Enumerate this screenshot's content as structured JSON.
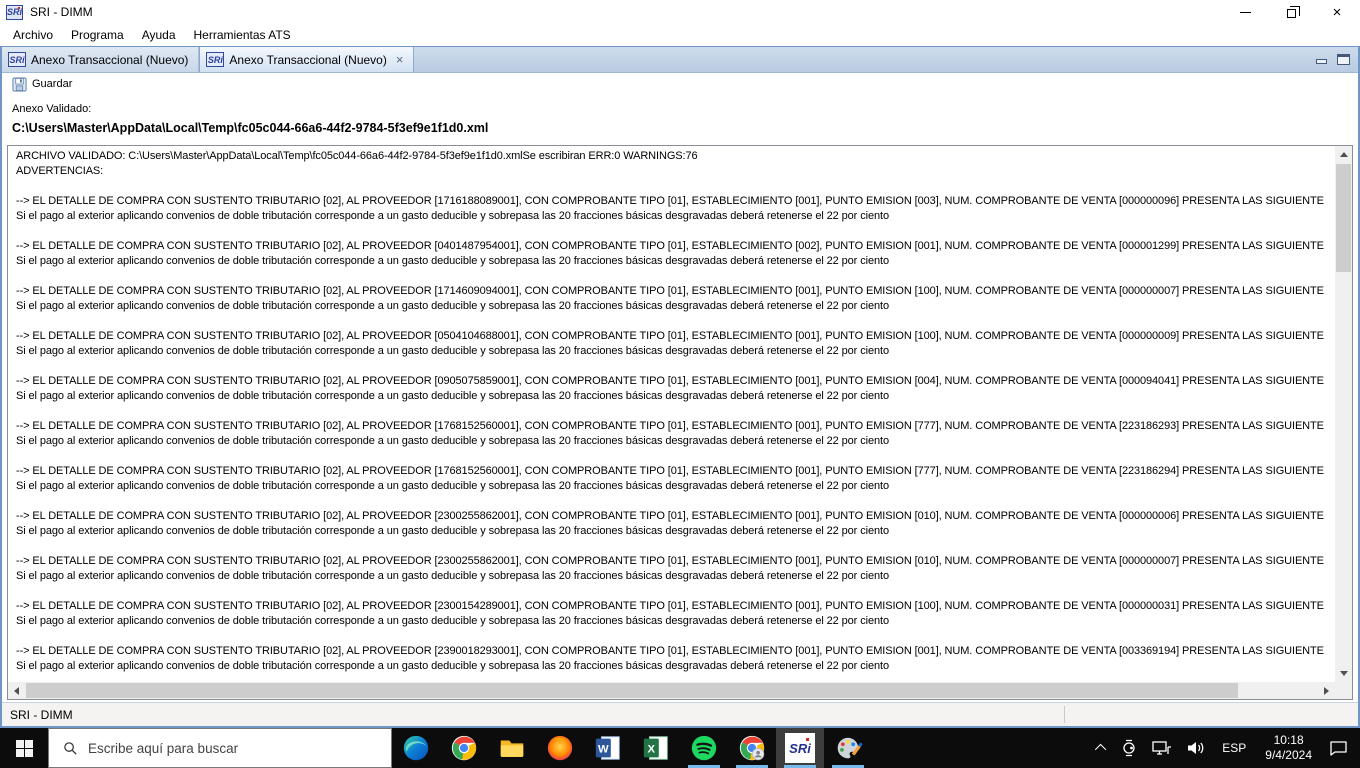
{
  "window": {
    "title": "SRI - DIMM",
    "logo_text": "SRi"
  },
  "menu": {
    "items": [
      {
        "label": "Archivo"
      },
      {
        "label": "Programa"
      },
      {
        "label": "Ayuda"
      },
      {
        "label": "Herramientas ATS"
      }
    ]
  },
  "tab_bar": {
    "tabs": [
      {
        "label": "Anexo Transaccional (Nuevo)",
        "active": false
      },
      {
        "label": "Anexo Transaccional (Nuevo)",
        "active": true,
        "close": "×"
      }
    ]
  },
  "toolbar": {
    "save_label": "Guardar"
  },
  "validation": {
    "label": "Anexo Validado:",
    "path": "C:\\Users\\Master\\AppData\\Local\\Temp\\fc05c044-66a6-44f2-9784-5f3ef9e1f1d0.xml"
  },
  "log": {
    "header": "ARCHIVO VALIDADO: C:\\Users\\Master\\AppData\\Local\\Temp\\fc05c044-66a6-44f2-9784-5f3ef9e1f1d0.xmlSe escribiran ERR:0 WARNINGS:76",
    "warnings_title": "ADVERTENCIAS:",
    "err_count": "0",
    "warning_count": "76",
    "warning_detail": "Si el pago al exterior aplicando convenios de doble tributación corresponde a un gasto deducible y sobrepasa las 20 fracciones básicas desgravadas deberá retenerse el 22 por ciento",
    "warnings": [
      {
        "line": "--> EL DETALLE DE COMPRA CON SUSTENTO TRIBUTARIO [02], AL PROVEEDOR [1716188089001], CON COMPROBANTE TIPO [01], ESTABLECIMIENTO [001], PUNTO EMISION [003], NUM. COMPROBANTE DE VENTA [000000096] PRESENTA LAS SIGUIENTE"
      },
      {
        "line": "--> EL DETALLE DE COMPRA CON SUSTENTO TRIBUTARIO [02], AL PROVEEDOR [0401487954001], CON COMPROBANTE TIPO [01], ESTABLECIMIENTO [002], PUNTO EMISION [001], NUM. COMPROBANTE DE VENTA [000001299] PRESENTA LAS SIGUIENTE"
      },
      {
        "line": "--> EL DETALLE DE COMPRA CON SUSTENTO TRIBUTARIO [02], AL PROVEEDOR [1714609094001], CON COMPROBANTE TIPO [01], ESTABLECIMIENTO [001], PUNTO EMISION [100], NUM. COMPROBANTE DE VENTA [000000007] PRESENTA LAS SIGUIENTE"
      },
      {
        "line": "--> EL DETALLE DE COMPRA CON SUSTENTO TRIBUTARIO [02], AL PROVEEDOR [0504104688001], CON COMPROBANTE TIPO [01], ESTABLECIMIENTO [001], PUNTO EMISION [100], NUM. COMPROBANTE DE VENTA [000000009] PRESENTA LAS SIGUIENTE"
      },
      {
        "line": "--> EL DETALLE DE COMPRA CON SUSTENTO TRIBUTARIO [02], AL PROVEEDOR [0905075859001], CON COMPROBANTE TIPO [01], ESTABLECIMIENTO [001], PUNTO EMISION [004], NUM. COMPROBANTE DE VENTA [000094041] PRESENTA LAS SIGUIENTE"
      },
      {
        "line": "--> EL DETALLE DE COMPRA CON SUSTENTO TRIBUTARIO [02], AL PROVEEDOR [1768152560001], CON COMPROBANTE TIPO [01], ESTABLECIMIENTO [001], PUNTO EMISION [777], NUM. COMPROBANTE DE VENTA [223186293] PRESENTA LAS SIGUIENTE"
      },
      {
        "line": "--> EL DETALLE DE COMPRA CON SUSTENTO TRIBUTARIO [02], AL PROVEEDOR [1768152560001], CON COMPROBANTE TIPO [01], ESTABLECIMIENTO [001], PUNTO EMISION [777], NUM. COMPROBANTE DE VENTA [223186294] PRESENTA LAS SIGUIENTE"
      },
      {
        "line": "--> EL DETALLE DE COMPRA CON SUSTENTO TRIBUTARIO [02], AL PROVEEDOR [2300255862001], CON COMPROBANTE TIPO [01], ESTABLECIMIENTO [001], PUNTO EMISION [010], NUM. COMPROBANTE DE VENTA [000000006] PRESENTA LAS SIGUIENTE"
      },
      {
        "line": "--> EL DETALLE DE COMPRA CON SUSTENTO TRIBUTARIO [02], AL PROVEEDOR [2300255862001], CON COMPROBANTE TIPO [01], ESTABLECIMIENTO [001], PUNTO EMISION [010], NUM. COMPROBANTE DE VENTA [000000007] PRESENTA LAS SIGUIENTE"
      },
      {
        "line": "--> EL DETALLE DE COMPRA CON SUSTENTO TRIBUTARIO [02], AL PROVEEDOR [2300154289001], CON COMPROBANTE TIPO [01], ESTABLECIMIENTO [001], PUNTO EMISION [100], NUM. COMPROBANTE DE VENTA [000000031] PRESENTA LAS SIGUIENTE"
      },
      {
        "line": "--> EL DETALLE DE COMPRA CON SUSTENTO TRIBUTARIO [02], AL PROVEEDOR [2390018293001], CON COMPROBANTE TIPO [01], ESTABLECIMIENTO [001], PUNTO EMISION [001], NUM. COMPROBANTE DE VENTA [003369194] PRESENTA LAS SIGUIENTE"
      }
    ]
  },
  "status_bar": {
    "text": "SRI - DIMM"
  },
  "taskbar": {
    "search_placeholder": "Escribe aquí para buscar",
    "language": "ESP",
    "time": "10:18",
    "date": "9/4/2024",
    "pinned_icons": [
      "edge",
      "chrome",
      "file-explorer",
      "firefox",
      "word",
      "excel",
      "spotify",
      "chrome-profile",
      "sri-dimm",
      "paint"
    ],
    "running_apps": [
      "spotify",
      "chrome-profile",
      "sri-dimm",
      "paint"
    ],
    "active_app": "sri-dimm"
  }
}
